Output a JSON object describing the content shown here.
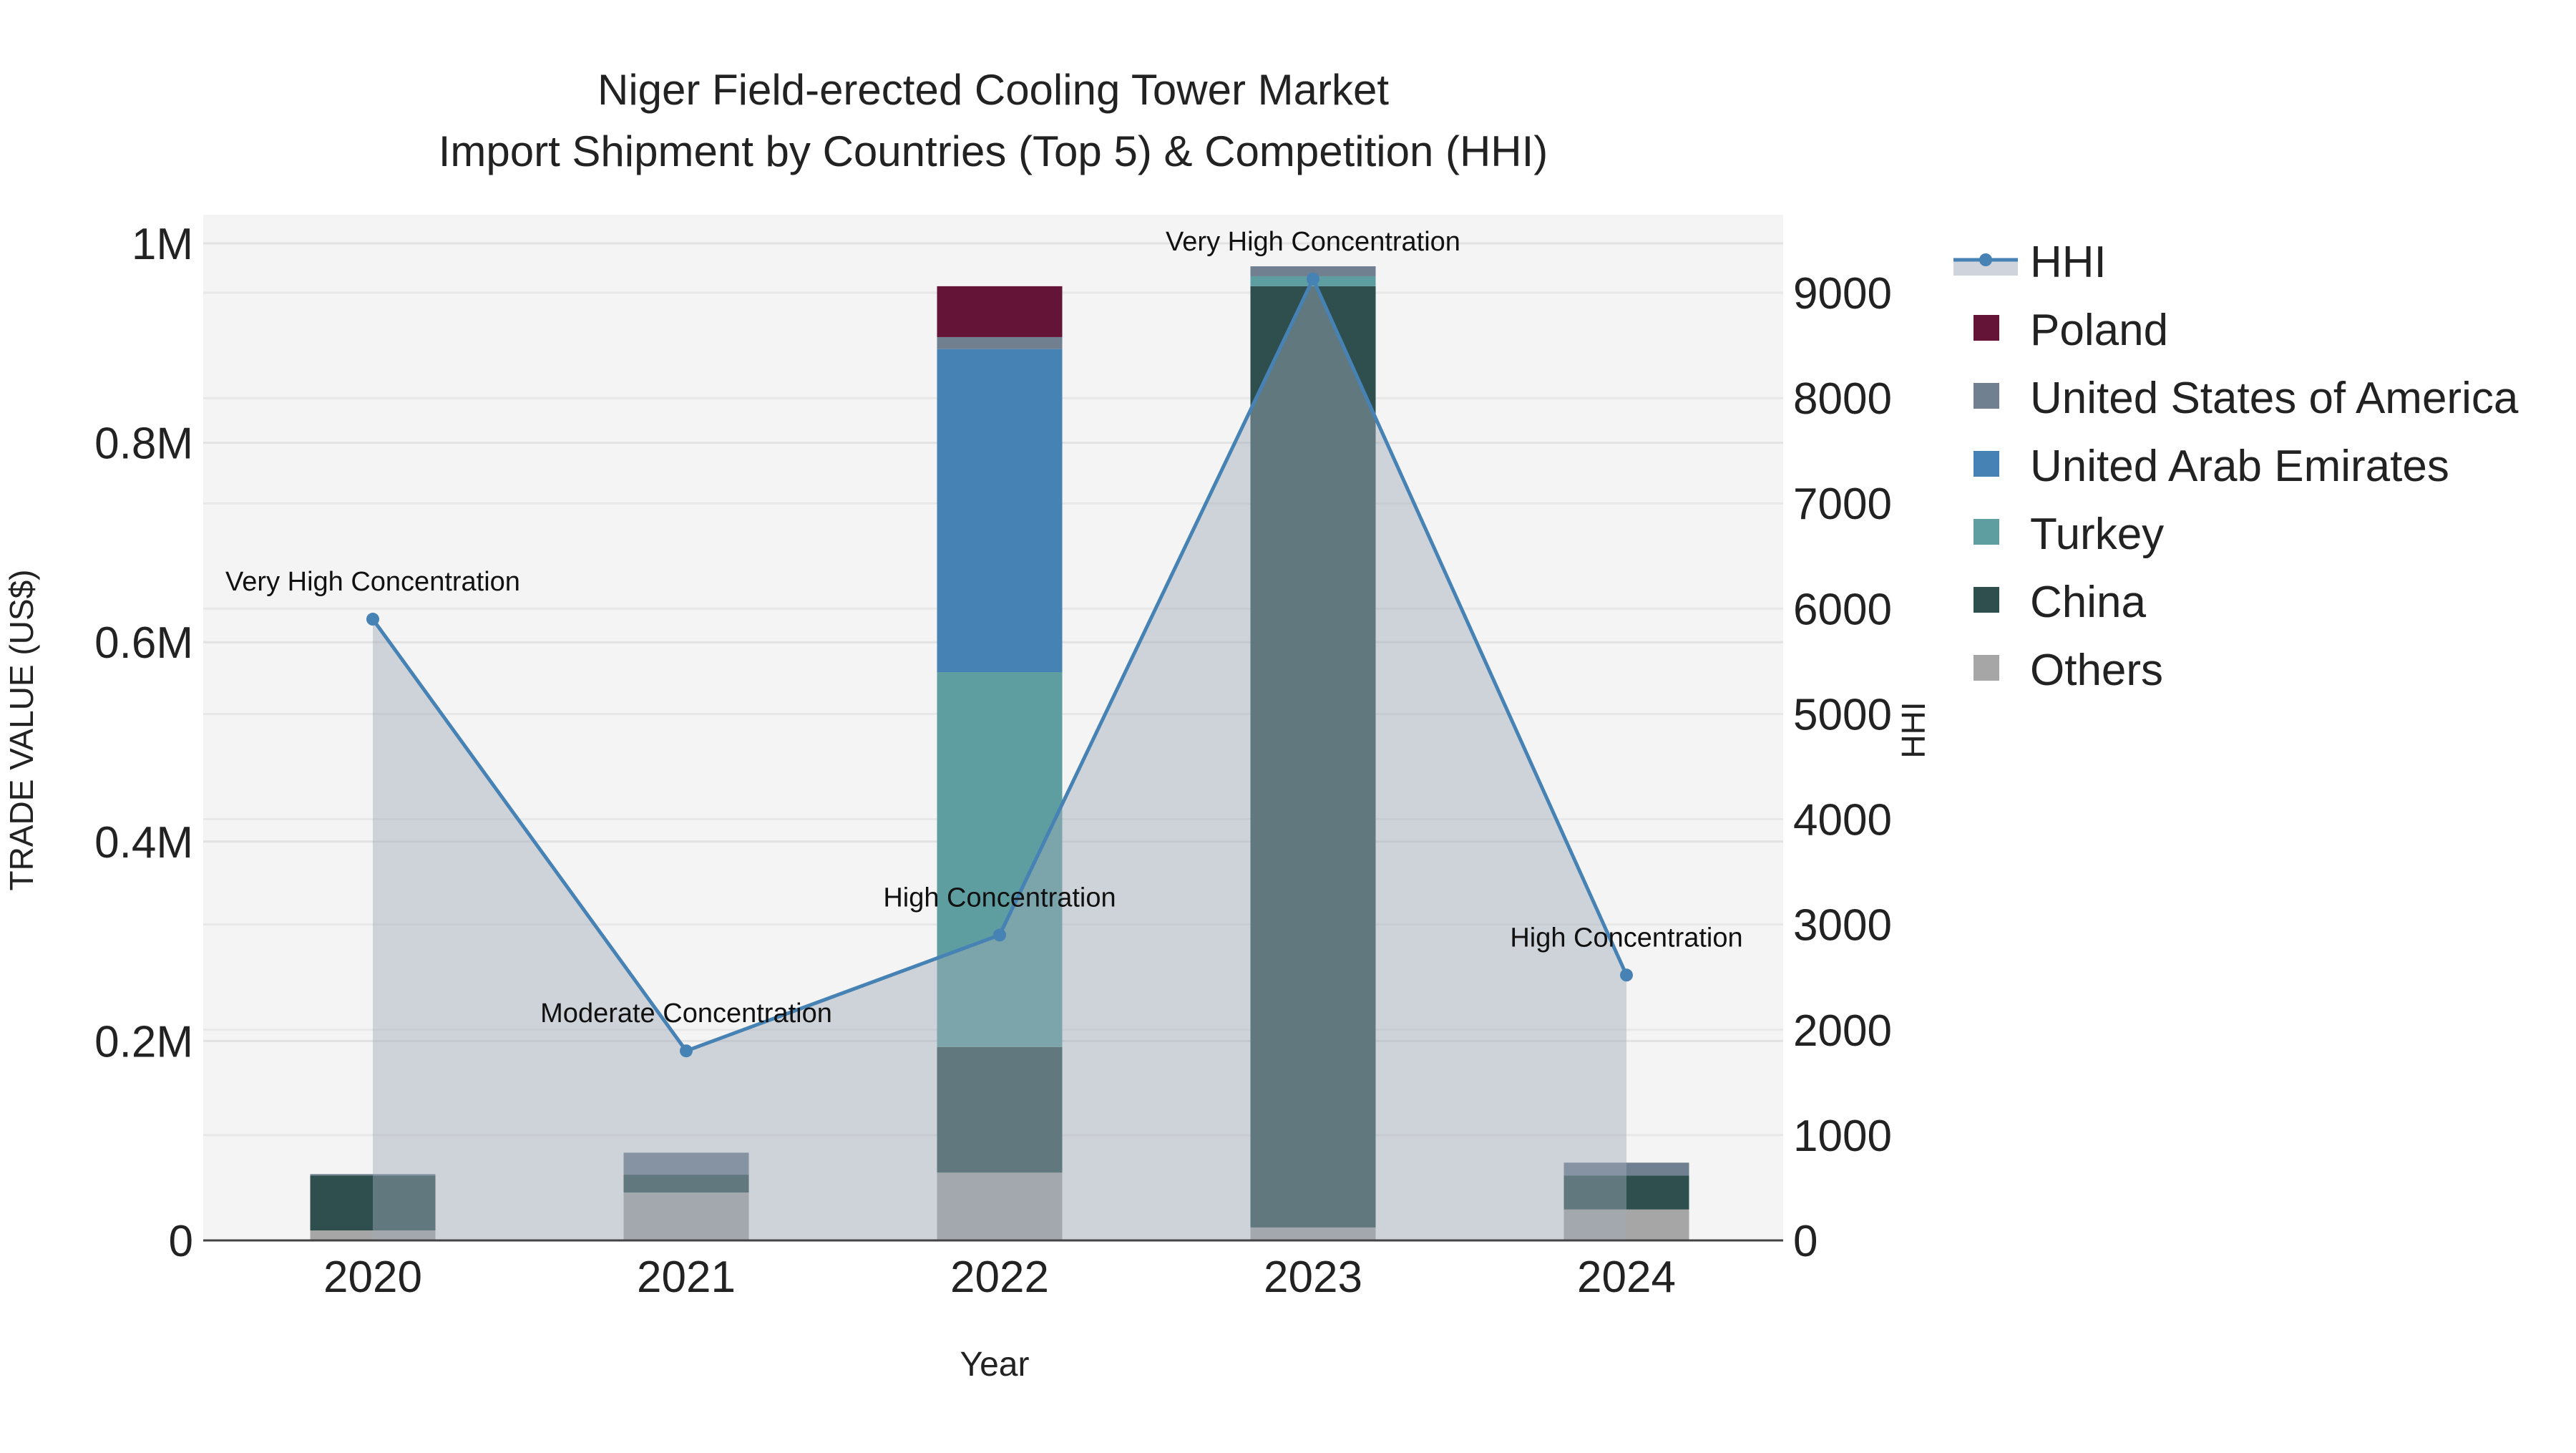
{
  "chart_data": {
    "type": "bar",
    "title_line1": "Niger Field-erected Cooling Tower Market",
    "title_line2": "Import Shipment by Countries (Top 5) & Competition (HHI)",
    "xlabel": "Year",
    "ylabel": "TRADE VALUE (US$)",
    "y2label": "HHI",
    "categories": [
      "2020",
      "2021",
      "2022",
      "2023",
      "2024"
    ],
    "ylim": [
      0,
      1000000
    ],
    "y_ticks": [
      0,
      200000,
      400000,
      600000,
      800000,
      1000000
    ],
    "y_tick_labels": [
      "0",
      "0.2M",
      "0.4M",
      "0.6M",
      "0.8M",
      "1M"
    ],
    "y2lim": [
      0,
      9000
    ],
    "y2_ticks": [
      0,
      1000,
      2000,
      3000,
      4000,
      5000,
      6000,
      7000,
      8000,
      9000
    ],
    "y2_tick_labels": [
      "0",
      "1000",
      "2000",
      "3000",
      "4000",
      "5000",
      "6000",
      "7000",
      "8000",
      "9000"
    ],
    "barmode": "stack",
    "series": [
      {
        "name": "Others",
        "color": "#a6a6a6",
        "values": [
          10000,
          48000,
          68000,
          13000,
          31000
        ]
      },
      {
        "name": "China",
        "color": "#2f4f4f",
        "values": [
          55000,
          18000,
          126000,
          944000,
          34000
        ]
      },
      {
        "name": "Turkey",
        "color": "#5f9ea0",
        "values": [
          0,
          0,
          376000,
          10000,
          0
        ]
      },
      {
        "name": "United Arab Emirates",
        "color": "#4682b4",
        "values": [
          0,
          0,
          324000,
          0,
          0
        ]
      },
      {
        "name": "United States of America",
        "color": "#708090",
        "values": [
          1500,
          22000,
          12000,
          10000,
          13000
        ]
      },
      {
        "name": "Poland",
        "color": "#641436",
        "values": [
          0,
          0,
          51000,
          0,
          0
        ]
      }
    ],
    "hhi": {
      "name": "HHI",
      "color": "#4682b4",
      "values": [
        5900,
        1800,
        2900,
        9130,
        2520
      ],
      "annotations": [
        "Very High Concentration",
        "Moderate Concentration",
        "High Concentration",
        "Very High Concentration",
        "High Concentration"
      ]
    },
    "legend": [
      "HHI",
      "Poland",
      "United States of America",
      "United Arab Emirates",
      "Turkey",
      "China",
      "Others"
    ],
    "legend_placement": "right",
    "grid": true
  }
}
